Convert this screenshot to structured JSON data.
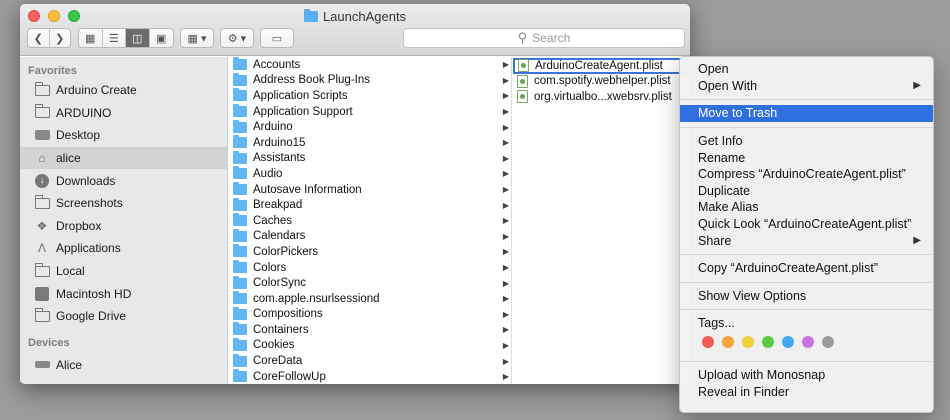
{
  "window": {
    "title": "LaunchAgents"
  },
  "search": {
    "placeholder": "Search"
  },
  "sidebar": {
    "favorites_heading": "Favorites",
    "items": [
      {
        "label": "Arduino Create",
        "icon": "folder-icon"
      },
      {
        "label": "ARDUINO",
        "icon": "folder-icon"
      },
      {
        "label": "Desktop",
        "icon": "desktop-icon"
      },
      {
        "label": "alice",
        "icon": "home-icon"
      },
      {
        "label": "Downloads",
        "icon": "downloads-icon"
      },
      {
        "label": "Screenshots",
        "icon": "folder-icon"
      },
      {
        "label": "Dropbox",
        "icon": "dropbox-icon"
      },
      {
        "label": "Applications",
        "icon": "applications-icon"
      },
      {
        "label": "Local",
        "icon": "folder-icon"
      },
      {
        "label": "Macintosh HD",
        "icon": "hard-drive-icon"
      },
      {
        "label": "Google Drive",
        "icon": "folder-icon"
      }
    ],
    "devices_heading": "Devices",
    "devices": [
      {
        "label": "Alice",
        "icon": "laptop-icon"
      }
    ]
  },
  "column1": [
    "Accounts",
    "Address Book Plug-Ins",
    "Application Scripts",
    "Application Support",
    "Arduino",
    "Arduino15",
    "Assistants",
    "Audio",
    "Autosave Information",
    "Breakpad",
    "Caches",
    "Calendars",
    "ColorPickers",
    "Colors",
    "ColorSync",
    "com.apple.nsurlsessiond",
    "Compositions",
    "Containers",
    "Cookies",
    "CoreData",
    "CoreFollowUp"
  ],
  "column2": [
    "ArduinoCreateAgent.plist",
    "com.spotify.webhelper.plist",
    "org.virtualbo...xwebsrv.plist"
  ],
  "context_menu": {
    "open": "Open",
    "open_with": "Open With",
    "move_to_trash": "Move to Trash",
    "get_info": "Get Info",
    "rename": "Rename",
    "compress": "Compress “ArduinoCreateAgent.plist”",
    "duplicate": "Duplicate",
    "make_alias": "Make Alias",
    "quick_look": "Quick Look “ArduinoCreateAgent.plist”",
    "share": "Share",
    "copy": "Copy “ArduinoCreateAgent.plist”",
    "show_view_options": "Show View Options",
    "tags": "Tags...",
    "upload_monosnap": "Upload with Monosnap",
    "reveal_in_finder": "Reveal in Finder"
  },
  "tag_colors": [
    "#f45a55",
    "#f8a23a",
    "#f3cf3b",
    "#5cc84b",
    "#45a8f5",
    "#c676de",
    "#9b9b9b"
  ],
  "colors": {
    "highlight": "#2f6fe0",
    "folder": "#64b6f5"
  }
}
